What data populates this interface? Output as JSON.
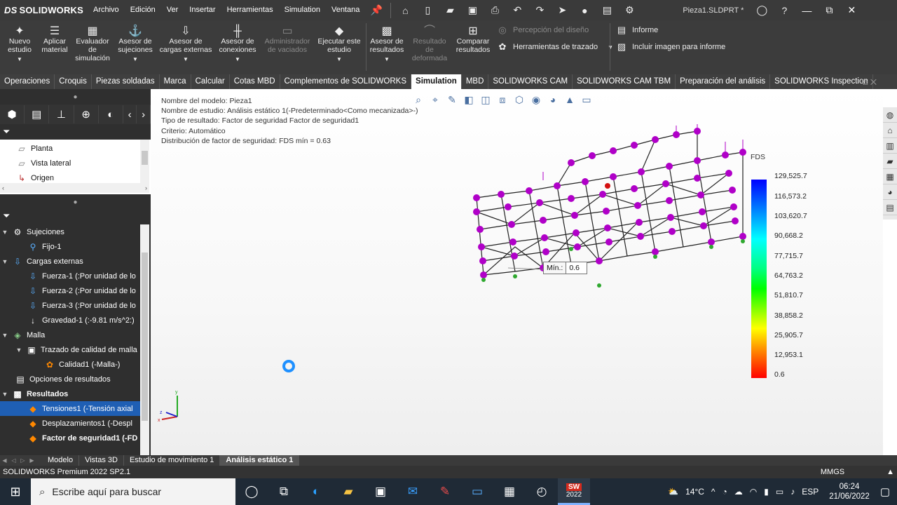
{
  "app": {
    "brand": "SOLIDWORKS",
    "brand_prefix": "DS",
    "document_title": "Pieza1.SLDPRT *"
  },
  "menu": [
    "Archivo",
    "Edición",
    "Ver",
    "Insertar",
    "Herramientas",
    "Simulation",
    "Ventana"
  ],
  "commands": {
    "nuevo_estudio": "Nuevo estudio",
    "aplicar_material": "Aplicar material",
    "evaluador": "Evaluador de simulación",
    "asesor_sujeciones": "Asesor de sujeciones",
    "asesor_cargas": "Asesor de cargas externas",
    "asesor_conexiones": "Asesor de conexiones",
    "admin_vaciados": "Administrador de vaciados",
    "ejecutar": "Ejecutar este estudio",
    "asesor_resultados": "Asesor de resultados",
    "resultado_deformada": "Resultado de deformada",
    "comparar": "Comparar resultados",
    "percepcion": "Percepción del diseño",
    "herramientas_trazado": "Herramientas de trazado",
    "informe": "Informe",
    "incluir_imagen": "Incluir imagen para informe"
  },
  "tabs": [
    "Operaciones",
    "Croquis",
    "Piezas soldadas",
    "Marca",
    "Calcular",
    "Cotas MBD",
    "Complementos de SOLIDWORKS",
    "Simulation",
    "MBD",
    "SOLIDWORKS CAM",
    "SOLIDWORKS CAM TBM",
    "Preparación del análisis",
    "SOLIDWORKS Inspection"
  ],
  "active_tab": "Simulation",
  "feature_tree": [
    "Planta",
    "Vista lateral",
    "Origen"
  ],
  "sim_tree": {
    "sujeciones": "Sujeciones",
    "fijo": "Fijo-1",
    "cargas": "Cargas externas",
    "fuerza1": "Fuerza-1 (:Por unidad de lo",
    "fuerza2": "Fuerza-2 (:Por unidad de lo",
    "fuerza3": "Fuerza-3 (:Por unidad de lo",
    "gravedad": "Gravedad-1 (:-9.81 m/s^2:)",
    "malla": "Malla",
    "trazado_calidad": "Trazado de calidad de malla",
    "calidad": "Calidad1 (-Malla-)",
    "opciones": "Opciones de resultados",
    "resultados": "Resultados",
    "tensiones": "Tensiones1 (-Tensión axial",
    "desplazamientos": "Desplazamientos1 (-Despl",
    "factor": "Factor de seguridad1 (-FD"
  },
  "study_info": {
    "modelo": "Nombre del modelo: Pieza1",
    "estudio": "Nombre de estudio: Análisis estático 1(-Predeterminado<Como mecanizada>-)",
    "tipo": "Tipo de resultado: Factor de seguridad Factor de seguridad1",
    "criterio": "Criterio: Automático",
    "distribucion": "Distribución de factor de seguridad: FDS mín = 0.63"
  },
  "legend": {
    "title": "FDS",
    "labels": [
      "129,525.7",
      "116,573.2",
      "103,620.7",
      "90,668.2",
      "77,715.7",
      "64,763.2",
      "51,810.7",
      "38,858.2",
      "25,905.7",
      "12,953.1",
      "0.6"
    ]
  },
  "min_tag": {
    "label": "Mín.:",
    "value": "0.6"
  },
  "bottom_tabs": [
    "Modelo",
    "Vistas 3D",
    "Estudio de movimiento 1",
    "Análisis estático 1"
  ],
  "active_bottom_tab": "Análisis estático 1",
  "status": {
    "left": "SOLIDWORKS Premium 2022 SP2.1",
    "units": "MMGS"
  },
  "taskbar": {
    "search_placeholder": "Escribe aquí para buscar",
    "temperature": "14°C",
    "language": "ESP",
    "time": "06:24",
    "date": "21/06/2022",
    "sw_badge": "2022"
  },
  "triad": {
    "x": "x",
    "y": "y",
    "z": "z"
  },
  "colors": {
    "accent": "#1f5fb4",
    "load_marker": "#b000c8",
    "dark_bg": "#2f2f2f"
  }
}
